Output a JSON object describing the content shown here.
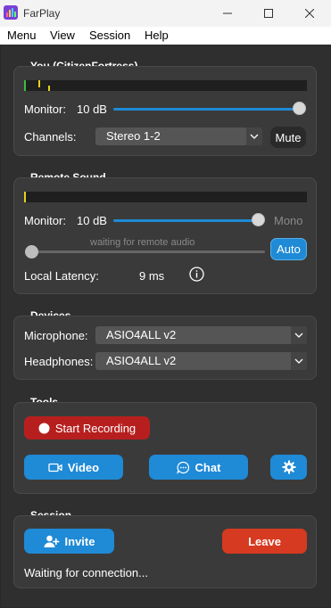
{
  "window": {
    "title": "FarPlay",
    "controls": {
      "minimize": "minimize-icon",
      "maximize": "maximize-icon",
      "close": "close-icon"
    }
  },
  "menu": {
    "items": [
      "Menu",
      "View",
      "Session",
      "Help"
    ]
  },
  "you": {
    "title": "You (CitizenFortress)",
    "monitor_label": "Monitor:",
    "monitor_value": "10 dB",
    "monitor_level": 1.0,
    "channels_label": "Channels:",
    "channels_value": "Stereo 1-2",
    "mute_label": "Mute"
  },
  "remote": {
    "title": "Remote Sound",
    "monitor_label": "Monitor:",
    "monitor_value": "10 dB",
    "monitor_level": 0.85,
    "mono_label": "Mono",
    "status_text": "waiting for remote audio",
    "auto_label": "Auto",
    "latency_label": "Local Latency:",
    "latency_value": "9 ms",
    "info_icon": "info-icon"
  },
  "devices": {
    "title": "Devices",
    "microphone_label": "Microphone:",
    "microphone_value": "ASIO4ALL v2",
    "headphones_label": "Headphones:",
    "headphones_value": "ASIO4ALL v2"
  },
  "tools": {
    "title": "Tools",
    "record_label": "Start Recording",
    "video_label": "Video",
    "chat_label": "Chat",
    "settings_icon": "gear-icon"
  },
  "session": {
    "title": "Session",
    "invite_label": "Invite",
    "leave_label": "Leave",
    "status": "Waiting for connection..."
  },
  "colors": {
    "accent_blue": "#1f8ad6",
    "record_red": "#b71f1f",
    "leave_red": "#d63a20",
    "meter_green": "#3bbf3b",
    "meter_yellow": "#e6d21a"
  }
}
